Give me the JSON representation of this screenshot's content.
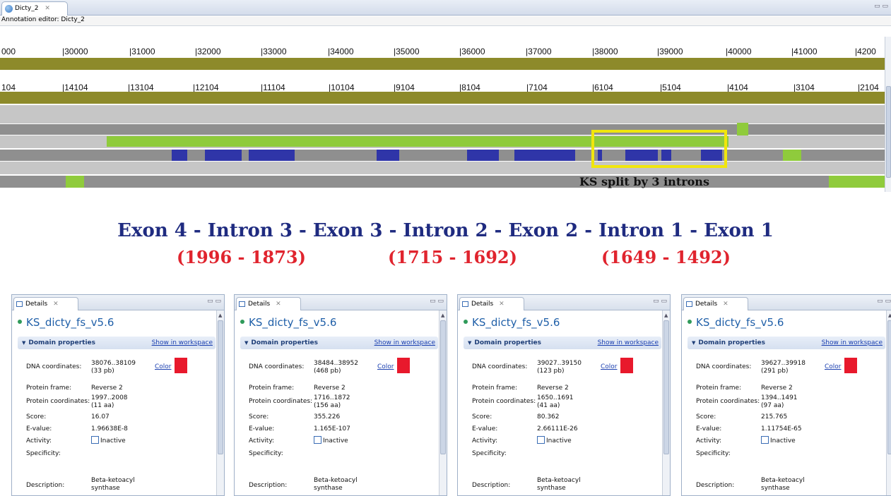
{
  "editor": {
    "tab_title": "Dicty_2",
    "tab_close": "✕",
    "window_controls": "▭ ▭",
    "subtitle": "Annotation editor: Dicty_2",
    "ruler_top": [
      "000",
      "30000",
      "31000",
      "32000",
      "33000",
      "34000",
      "35000",
      "36000",
      "37000",
      "38000",
      "39000",
      "40000",
      "41000",
      "4200"
    ],
    "ruler_bottom": [
      "104",
      "14104",
      "13104",
      "12104",
      "11104",
      "10104",
      "9104",
      "8104",
      "7104",
      "6104",
      "5104",
      "4104",
      "3104",
      "2104"
    ],
    "highlight_label": "KS split by 3 introns",
    "colors": {
      "olive": "#8d8a2a",
      "light_gray": "#c5c5c5",
      "dark_gray": "#8f8f8f",
      "green": "#8fcb3c",
      "blue": "#2f35a8",
      "highlight": "#f1e60c"
    }
  },
  "exon_line": "Exon 4 - Intron 3 - Exon 3 - Intron 2 - Exon 2 - Intron 1 - Exon 1",
  "intron_coords": [
    "(1996 - 1873)",
    "(1715 - 1692)",
    "(1649 - 1492)"
  ],
  "panels": [
    {
      "tab": "Details",
      "title": "KS_dicty_fs_v5.6",
      "section": "Domain properties",
      "show_link": "Show in workspace",
      "labels": {
        "dna": "DNA coordinates:",
        "frame": "Protein frame:",
        "protein": "Protein coordinates:",
        "score": "Score:",
        "evalue": "E-value:",
        "activity": "Activity:",
        "specificity": "Specificity:",
        "description": "Description:"
      },
      "dna_1": "38076..38109",
      "dna_2": "(33 pb)",
      "color_link": "Color",
      "frame": "Reverse 2",
      "protein_1": "1997..2008",
      "protein_2": "(11 aa)",
      "score": "16.07",
      "evalue": "1.96638E-8",
      "activity": "Inactive",
      "description_1": "Beta-ketoacyl",
      "description_2": "synthase"
    },
    {
      "tab": "Details",
      "title": "KS_dicty_fs_v5.6",
      "section": "Domain properties",
      "show_link": "Show in workspace",
      "labels": {
        "dna": "DNA coordinates:",
        "frame": "Protein frame:",
        "protein": "Protein coordinates:",
        "score": "Score:",
        "evalue": "E-value:",
        "activity": "Activity:",
        "specificity": "Specificity:",
        "description": "Description:"
      },
      "dna_1": "38484..38952",
      "dna_2": "(468 pb)",
      "color_link": "Color",
      "frame": "Reverse 2",
      "protein_1": "1716..1872",
      "protein_2": "(156 aa)",
      "score": "355.226",
      "evalue": "1.165E-107",
      "activity": "Inactive",
      "description_1": "Beta-ketoacyl",
      "description_2": "synthase"
    },
    {
      "tab": "Details",
      "title": "KS_dicty_fs_v5.6",
      "section": "Domain properties",
      "show_link": "Show in workspace",
      "labels": {
        "dna": "DNA coordinates:",
        "frame": "Protein frame:",
        "protein": "Protein coordinates:",
        "score": "Score:",
        "evalue": "E-value:",
        "activity": "Activity:",
        "specificity": "Specificity:",
        "description": "Description:"
      },
      "dna_1": "39027..39150",
      "dna_2": "(123 pb)",
      "color_link": "Color",
      "frame": "Reverse 2",
      "protein_1": "1650..1691",
      "protein_2": "(41 aa)",
      "score": "80.362",
      "evalue": "2.66111E-26",
      "activity": "Inactive",
      "description_1": "Beta-ketoacyl",
      "description_2": "synthase"
    },
    {
      "tab": "Details",
      "title": "KS_dicty_fs_v5.6",
      "section": "Domain properties",
      "show_link": "Show in workspace",
      "labels": {
        "dna": "DNA coordinates:",
        "frame": "Protein frame:",
        "protein": "Protein coordinates:",
        "score": "Score:",
        "evalue": "E-value:",
        "activity": "Activity:",
        "specificity": "Specificity:",
        "description": "Description:"
      },
      "dna_1": "39627..39918",
      "dna_2": "(291 pb)",
      "color_link": "Color",
      "frame": "Reverse 2",
      "protein_1": "1394..1491",
      "protein_2": "(97 aa)",
      "score": "215.765",
      "evalue": "1.11754E-65",
      "activity": "Inactive",
      "description_1": "Beta-ketoacyl",
      "description_2": "synthase"
    }
  ]
}
